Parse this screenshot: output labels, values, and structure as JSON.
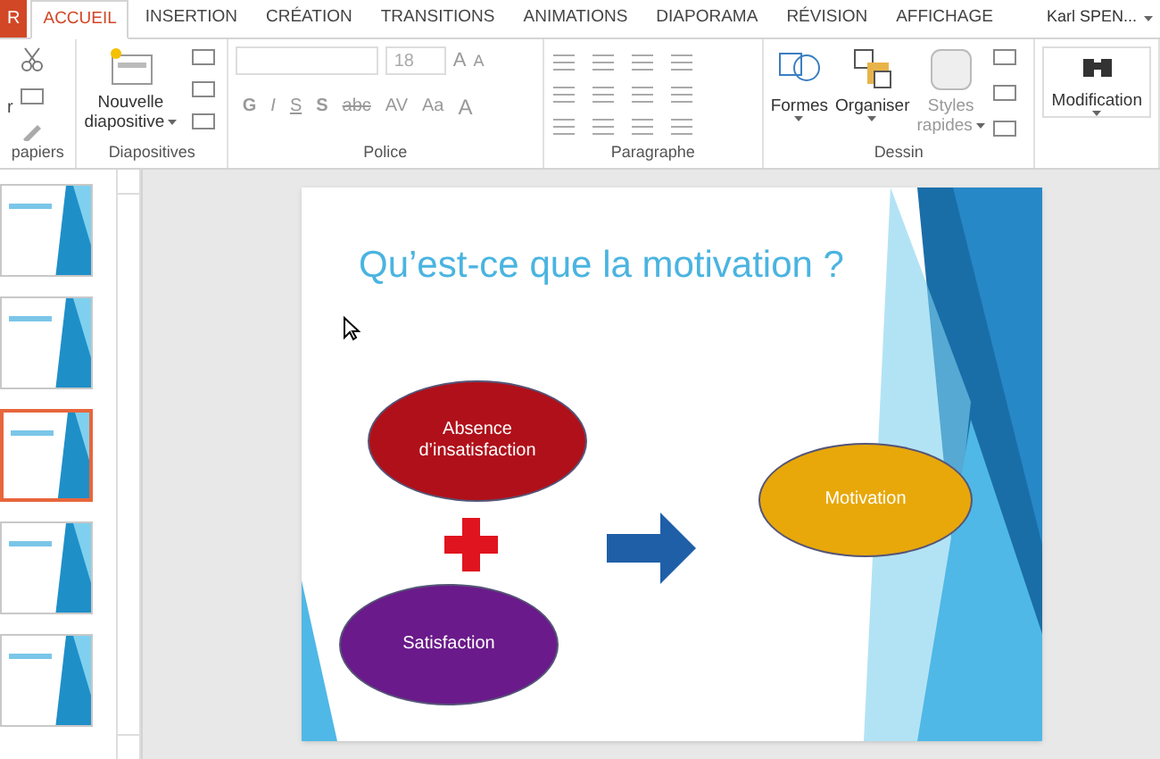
{
  "file_tab": "R",
  "tabs": [
    {
      "label": "ACCUEIL",
      "kind": "tab",
      "selected": true
    },
    {
      "label": "INSERTION",
      "kind": "tab",
      "selected": false
    },
    {
      "label": "CRÉATION",
      "kind": "tab",
      "selected": false
    },
    {
      "label": "TRANSITIONS",
      "kind": "tab",
      "selected": false
    },
    {
      "label": "ANIMATIONS",
      "kind": "tab",
      "selected": false
    },
    {
      "label": "DIAPORAMA",
      "kind": "tab",
      "selected": false
    },
    {
      "label": "RÉVISION",
      "kind": "tab",
      "selected": false
    },
    {
      "label": "AFFICHAGE",
      "kind": "tab",
      "selected": false
    }
  ],
  "user": "Karl SPEN...",
  "ribbon": {
    "clipboard": {
      "label": "papiers",
      "paste_label": "r"
    },
    "slides": {
      "label": "Diapositives",
      "new_slide": [
        "Nouvelle",
        "diapositive"
      ]
    },
    "font": {
      "label": "Police",
      "size": "18",
      "grow": "A",
      "shrink": "A",
      "bold": "G",
      "italic": "I",
      "underline": "S",
      "shadow": "S",
      "strike": "abc",
      "spacing": "AV",
      "case": "Aa",
      "font_color": "A"
    },
    "paragraph": {
      "label": "Paragraphe"
    },
    "drawing": {
      "label": "Dessin",
      "shapes": "Formes",
      "arrange": "Organiser",
      "styles": [
        "Styles",
        "rapides"
      ]
    },
    "editing": {
      "label": "Modification"
    }
  },
  "thumbnails": [
    {
      "selected": false
    },
    {
      "selected": false
    },
    {
      "selected": true
    },
    {
      "selected": false
    },
    {
      "selected": false
    }
  ],
  "slide": {
    "title": "Qu’est-ce que la motivation ?",
    "shapes": [
      {
        "kind": "ellipse",
        "text": "Absence d’insatisfaction",
        "color": "#b0101a"
      },
      {
        "kind": "ellipse",
        "text": "Satisfaction",
        "color": "#6a1a8a"
      },
      {
        "kind": "ellipse",
        "text": "Motivation",
        "color": "#e8a80a"
      }
    ]
  }
}
